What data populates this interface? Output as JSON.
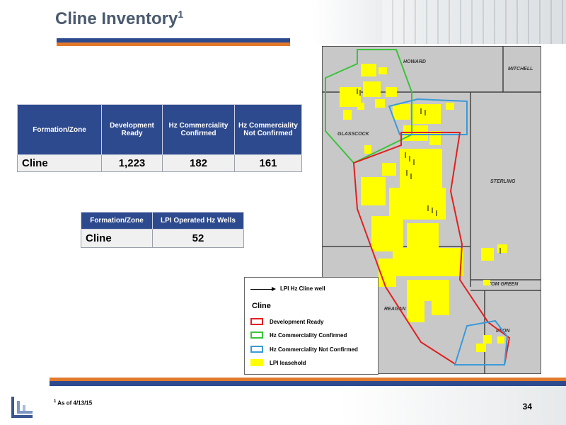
{
  "title": {
    "text": "Cline Inventory",
    "superscript": "1"
  },
  "table_inventory": {
    "headers": [
      "Formation/Zone",
      "Development Ready",
      "Hz Commerciality Confirmed",
      "Hz Commerciality Not Confirmed"
    ],
    "rows": [
      [
        "Cline",
        "1,223",
        "182",
        "161"
      ]
    ]
  },
  "table_wells": {
    "headers": [
      "Formation/Zone",
      "LPI Operated Hz Wells"
    ],
    "rows": [
      [
        "Cline",
        "52"
      ]
    ]
  },
  "map": {
    "counties": [
      "HOWARD",
      "MITCHELL",
      "GLASSCOCK",
      "STERLING",
      "REAGAN",
      "TOM GREEN",
      "IRION"
    ]
  },
  "legend": {
    "arrow_label": "LPI Hz Cline well",
    "title": "Cline",
    "items": [
      {
        "label": "Development Ready",
        "color": "#e02020",
        "style": "outline"
      },
      {
        "label": "Hz Commerciality Confirmed",
        "color": "#3ac43a",
        "style": "outline"
      },
      {
        "label": "Hz Commerciality Not Confirmed",
        "color": "#3a9ad8",
        "style": "outline"
      },
      {
        "label": "LPI leasehold",
        "color": "#ffff00",
        "style": "fill"
      }
    ]
  },
  "footnote": {
    "superscript": "1",
    "text": " As of 4/13/15"
  },
  "page_number": "34",
  "colors": {
    "title": "#4a5a6e",
    "header_fill": "#2e4a8e",
    "band_blue": "#2e4a8e",
    "band_orange": "#e2792b",
    "map_bg": "#c8c8c8",
    "lease": "#ffff00"
  }
}
